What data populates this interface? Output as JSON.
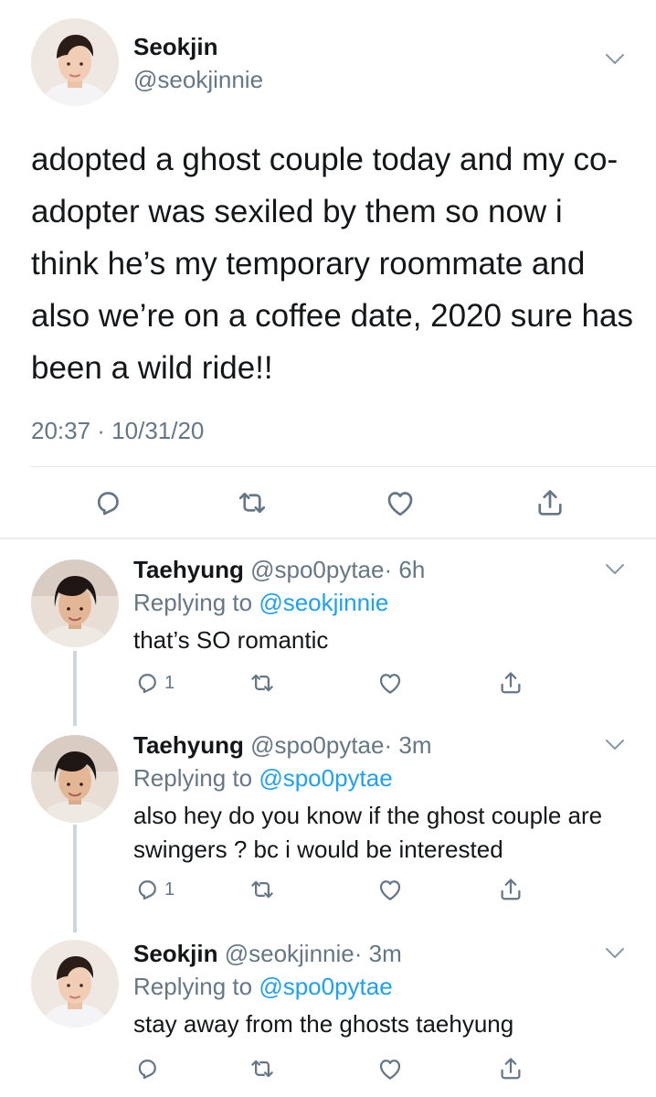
{
  "main_tweet": {
    "author_name": "Seokjin",
    "author_handle": "@seokjinnie",
    "text": "adopted a ghost couple today and my co-adopter was sexiled by them so now i think he’s my temporary roommate and also we’re on a coffee date, 2020 sure has been a wild ride!!",
    "timestamp": "20:37 · 10/31/20",
    "actions": [
      "reply-icon",
      "retweet-icon",
      "like-icon",
      "share-icon"
    ]
  },
  "replies": [
    {
      "name": "Taehyung",
      "handle": "@spo0pytae",
      "time": "· 6h",
      "replying_prefix": "Replying to",
      "replying_to": "@seokjinnie",
      "text": "that’s SO romantic",
      "reply_count": "1"
    },
    {
      "name": "Taehyung",
      "handle": "@spo0pytae",
      "time": "· 3m",
      "replying_prefix": "Replying to",
      "replying_to": "@spo0pytae",
      "text": "also hey do you know if the ghost couple are swingers ? bc i would be interested",
      "reply_count": "1"
    },
    {
      "name": "Seokjin",
      "handle": "@seokjinnie",
      "time": "· 3m",
      "replying_prefix": "Replying to",
      "replying_to": "@spo0pytae",
      "text": "stay away from the ghosts taehyung",
      "reply_count": ""
    }
  ],
  "colors": {
    "text": "#14171a",
    "secondary": "#657786",
    "link": "#1da1f2",
    "divider": "#e1e8ed",
    "thread_line": "#ccd6dd"
  }
}
